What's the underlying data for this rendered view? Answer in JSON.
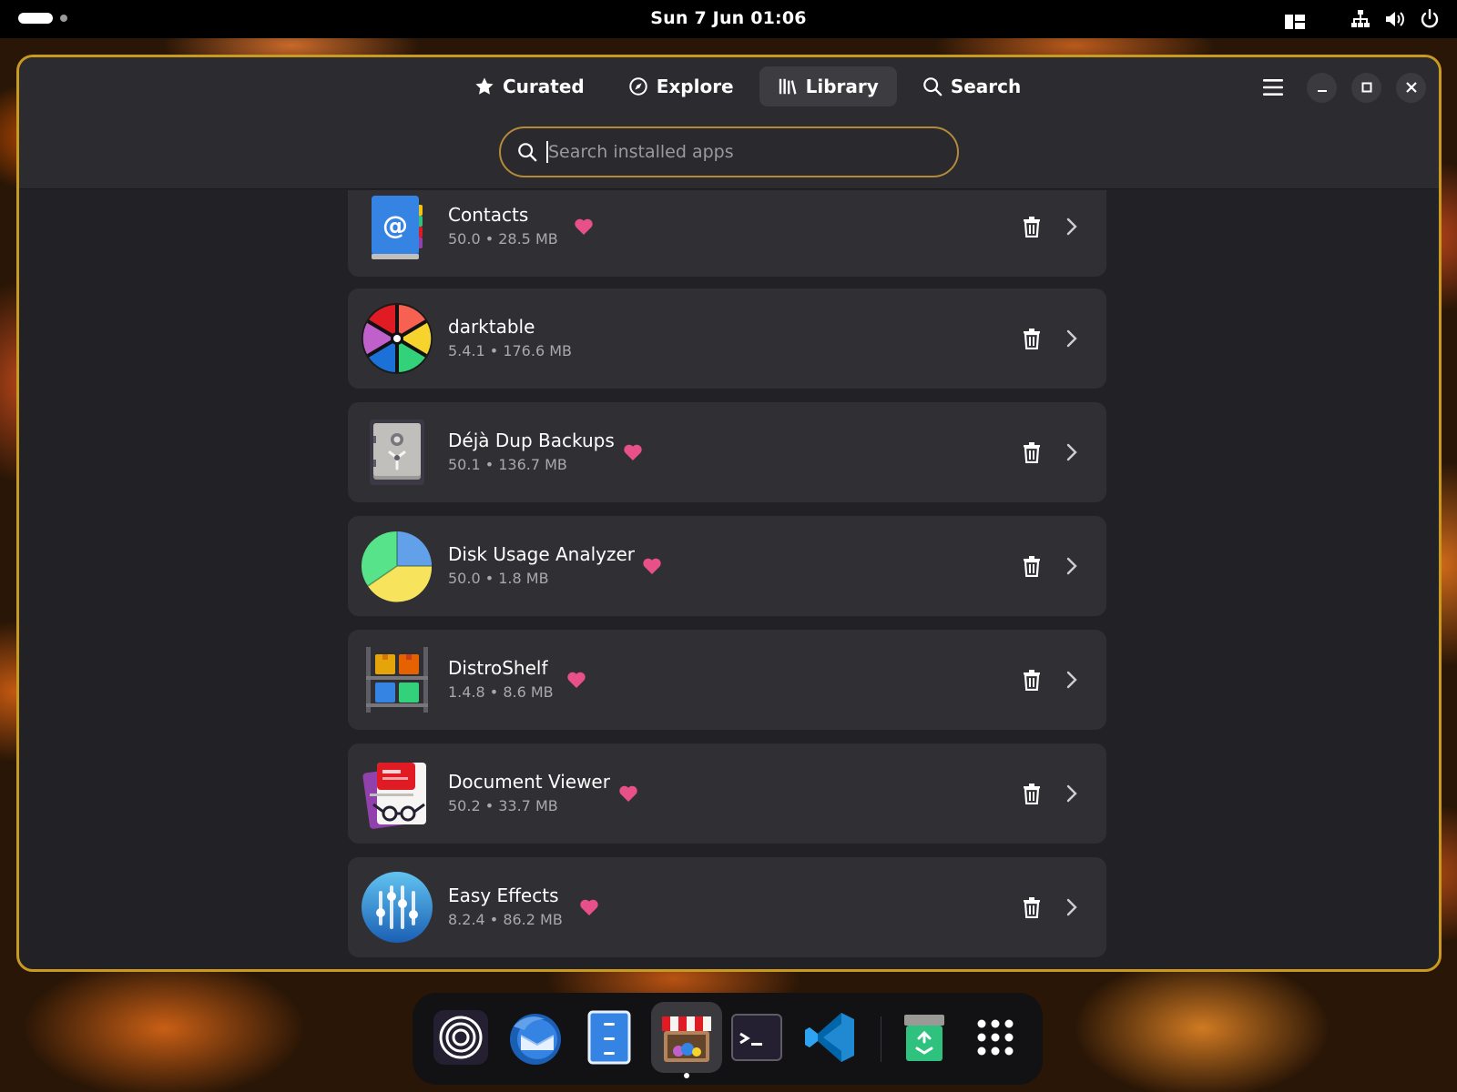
{
  "topbar": {
    "clock": "Sun 7 Jun  01:06"
  },
  "window": {
    "tabs": [
      {
        "label": "Curated",
        "icon": "star-icon",
        "active": false
      },
      {
        "label": "Explore",
        "icon": "compass-icon",
        "active": false
      },
      {
        "label": "Library",
        "icon": "library-icon",
        "active": true
      },
      {
        "label": "Search",
        "icon": "search-icon",
        "active": false
      }
    ],
    "search": {
      "placeholder": "Search installed apps",
      "value": ""
    }
  },
  "apps": [
    {
      "name": "Contacts",
      "meta": "50.0 • 28.5 MB",
      "favorite": true,
      "icon": "contacts-icon"
    },
    {
      "name": "darktable",
      "meta": "5.4.1 • 176.6 MB",
      "favorite": false,
      "icon": "darktable-icon"
    },
    {
      "name": "Déjà Dup Backups",
      "meta": "50.1 • 136.7 MB",
      "favorite": true,
      "icon": "deja-dup-icon"
    },
    {
      "name": "Disk Usage Analyzer",
      "meta": "50.0 • 1.8 MB",
      "favorite": true,
      "icon": "disk-usage-icon"
    },
    {
      "name": "DistroShelf",
      "meta": "1.4.8 • 8.6 MB",
      "favorite": true,
      "icon": "distroshelf-icon"
    },
    {
      "name": "Document Viewer",
      "meta": "50.2 • 33.7 MB",
      "favorite": true,
      "icon": "document-viewer-icon"
    },
    {
      "name": "Easy Effects",
      "meta": "8.2.4 • 86.2 MB",
      "favorite": true,
      "icon": "easy-effects-icon"
    }
  ],
  "dock": [
    {
      "icon": "spiral-app-icon",
      "running": false
    },
    {
      "icon": "thunderbird-icon",
      "running": false
    },
    {
      "icon": "file-cabinet-icon",
      "running": false
    },
    {
      "icon": "app-store-icon",
      "running": true
    },
    {
      "icon": "terminal-icon",
      "running": false
    },
    {
      "icon": "vscode-icon",
      "running": false
    },
    {
      "icon": "trash-bin-icon",
      "running": false
    },
    {
      "icon": "app-grid-icon",
      "running": false
    }
  ],
  "colors": {
    "accent_border": "#c99a1f",
    "heart": "#e8508a",
    "window_bg": "#222226",
    "card_bg": "#303034"
  }
}
